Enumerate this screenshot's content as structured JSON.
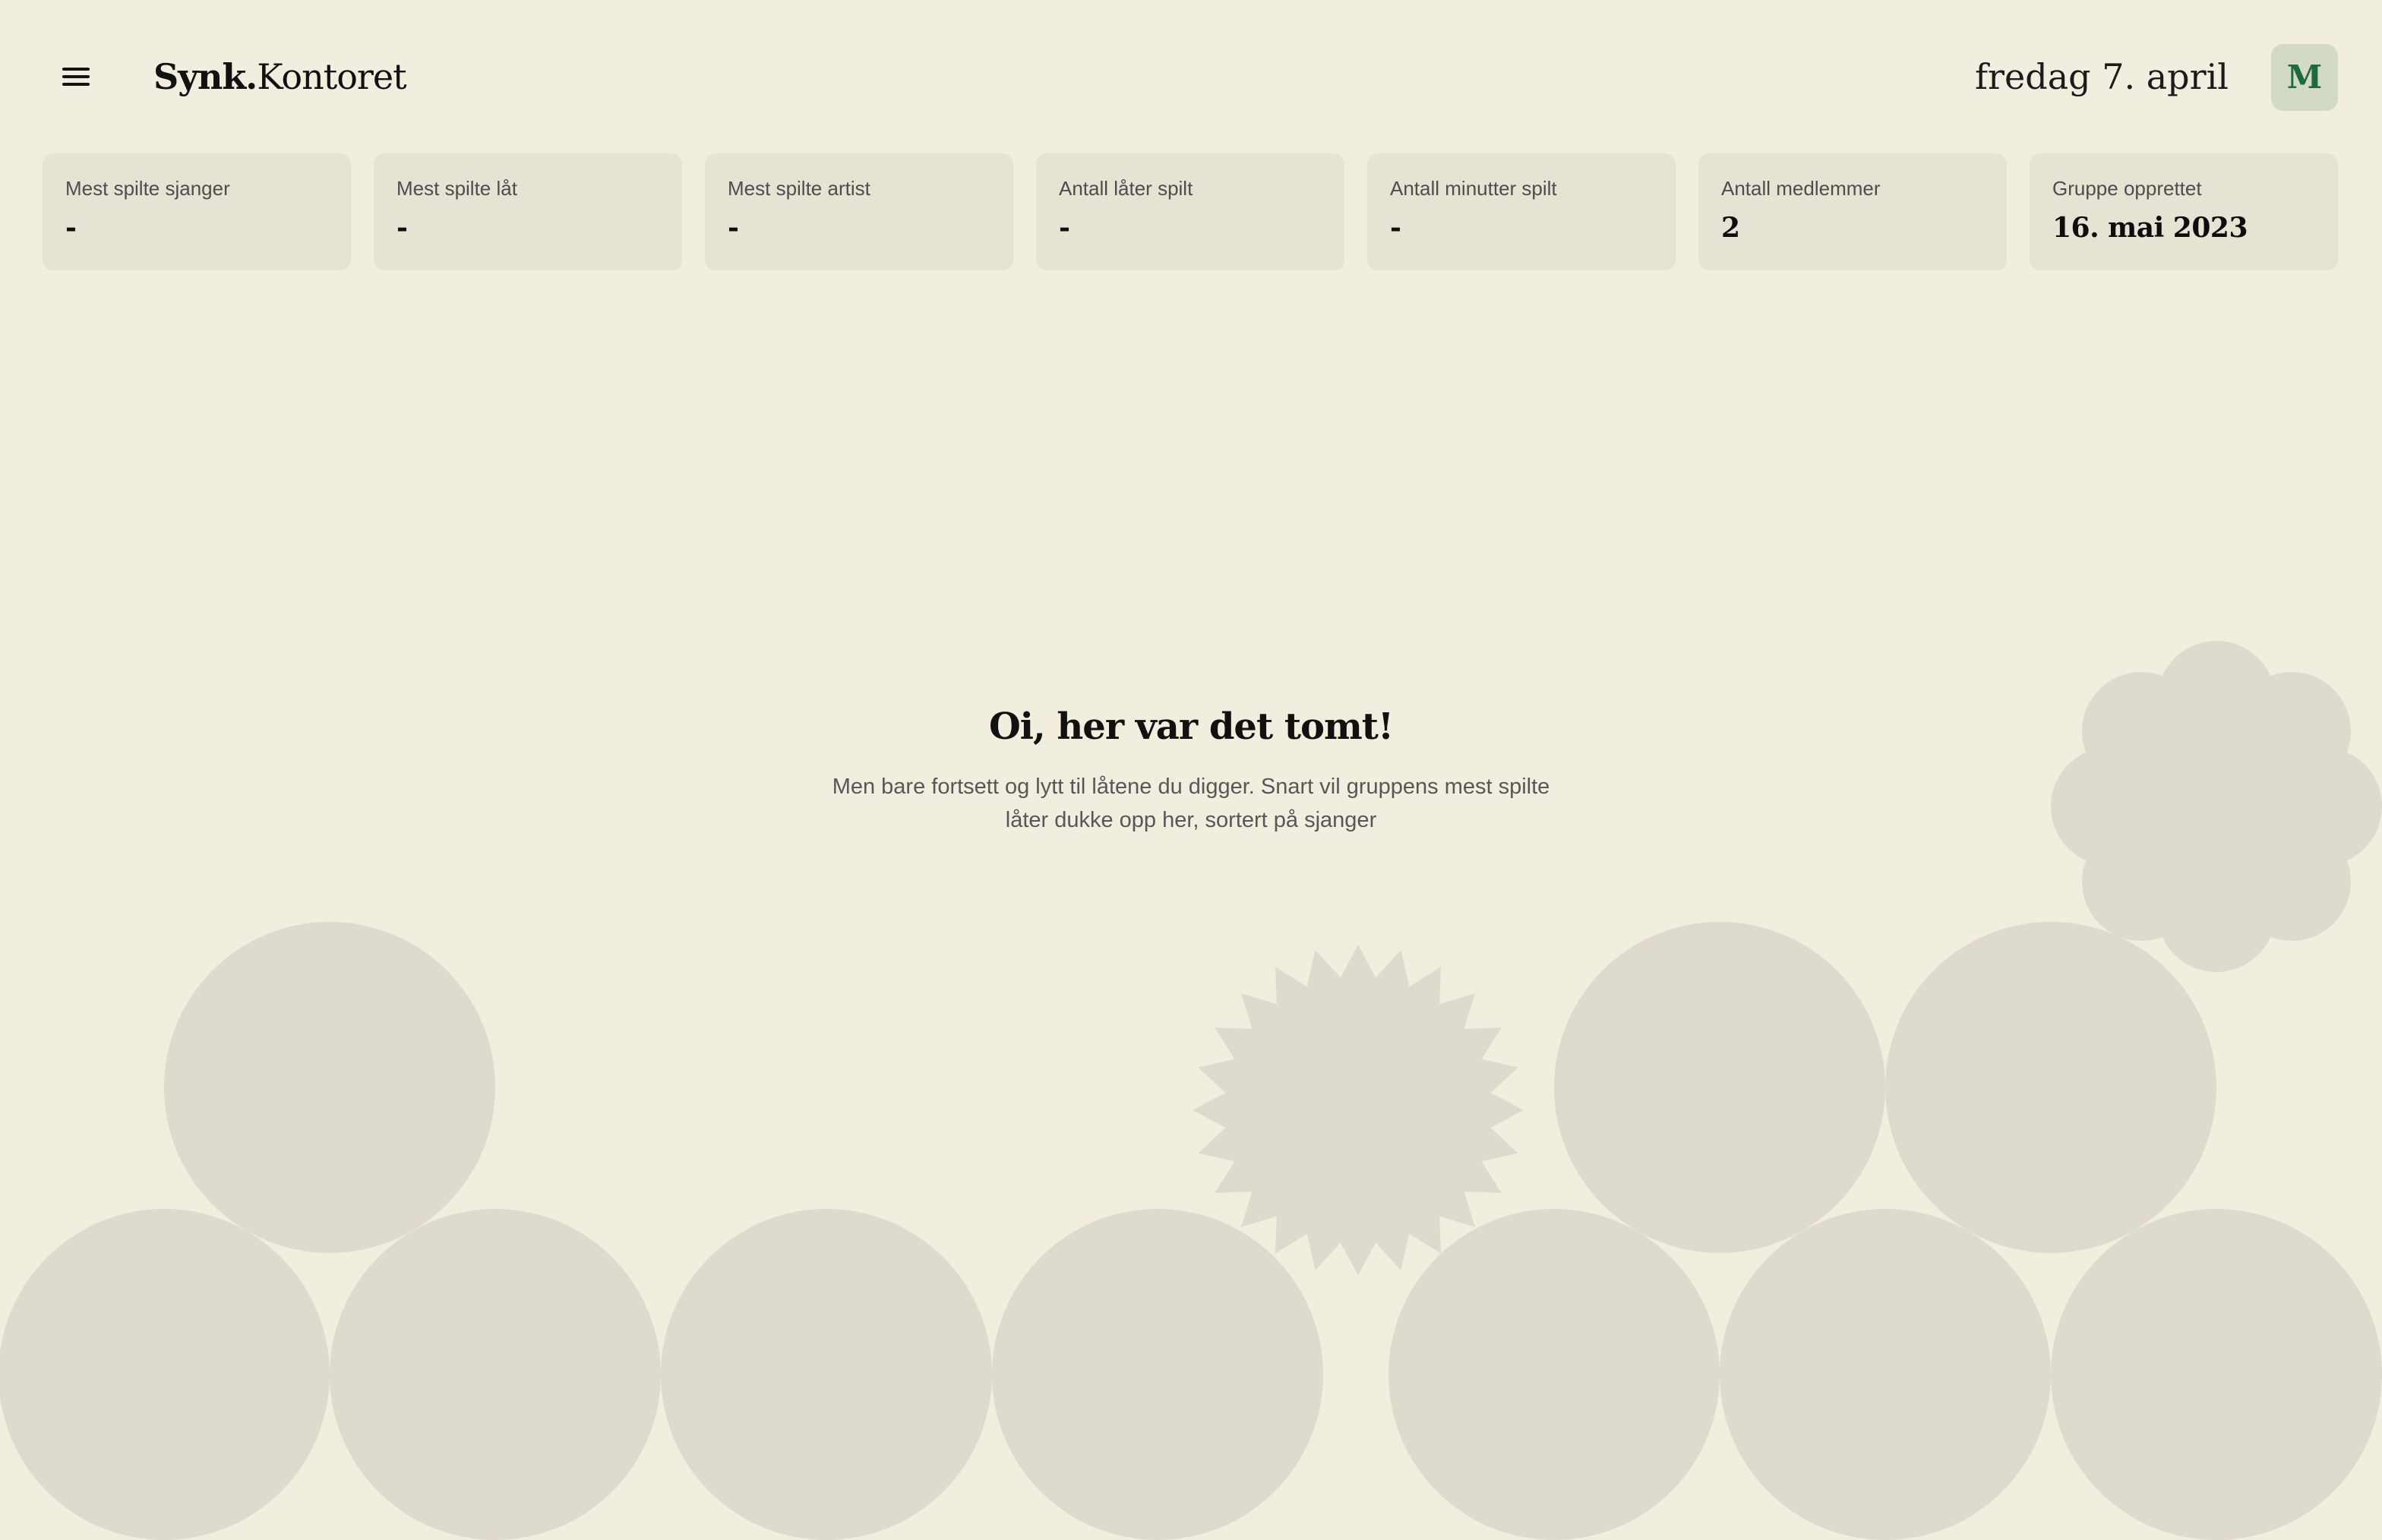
{
  "header": {
    "brand_bold": "Synk.",
    "brand_light": "Kontoret",
    "date": "fredag 7. april",
    "avatar_initial": "M"
  },
  "stats": [
    {
      "label": "Mest spilte sjanger",
      "value": "-"
    },
    {
      "label": "Mest spilte låt",
      "value": "-"
    },
    {
      "label": "Mest spilte artist",
      "value": "-"
    },
    {
      "label": "Antall låter spilt",
      "value": "-"
    },
    {
      "label": "Antall minutter spilt",
      "value": "-"
    },
    {
      "label": "Antall medlemmer",
      "value": "2"
    },
    {
      "label": "Gruppe opprettet",
      "value": "16. mai 2023"
    }
  ],
  "empty_state": {
    "title": "Oi, her var det tomt!",
    "text": "Men bare fortsett og lytt til låtene du digger. Snart vil gruppens mest spilte låter dukke opp her, sortert på sjanger"
  },
  "colors": {
    "background": "#f1eddf",
    "card": "#e6e2d4",
    "shape": "#dedacd",
    "avatar_bg": "#d2d9c6",
    "avatar_fg": "#1e6a3a"
  }
}
